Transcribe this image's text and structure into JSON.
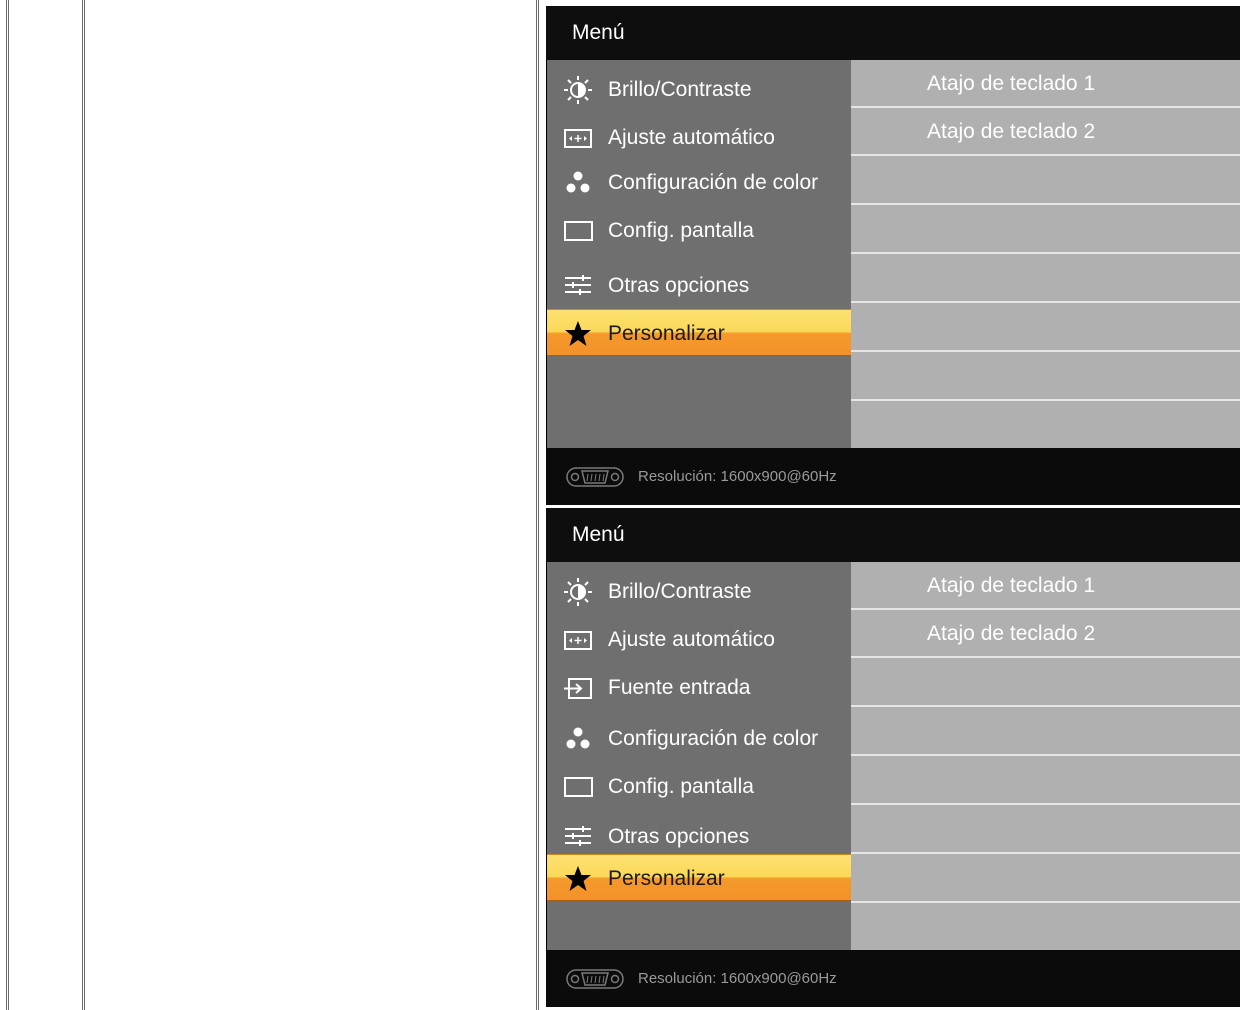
{
  "osd_one": {
    "title": "Menú",
    "menu": [
      {
        "label": "Brillo/Contraste",
        "icon": "brightness-icon"
      },
      {
        "label": "Ajuste automático",
        "icon": "auto-adjust-icon"
      },
      {
        "label": "Configuración de color",
        "icon": "color-dots-icon"
      },
      {
        "label": "Config. pantalla",
        "icon": "display-rect-icon"
      },
      {
        "label": "Otras opciones",
        "icon": "sliders-icon"
      },
      {
        "label": "Personalizar",
        "icon": "star-icon",
        "selected": true
      }
    ],
    "submenu": [
      "Atajo de teclado 1",
      "Atajo de teclado 2"
    ],
    "footer": {
      "resolution": "Resolución:  1600x900@60Hz",
      "icon": "vga-connector-icon"
    }
  },
  "osd_two": {
    "title": "Menú",
    "menu": [
      {
        "label": "Brillo/Contraste",
        "icon": "brightness-icon"
      },
      {
        "label": "Ajuste automático",
        "icon": "auto-adjust-icon"
      },
      {
        "label": "Fuente entrada",
        "icon": "input-source-icon"
      },
      {
        "label": "Configuración de color",
        "icon": "color-dots-icon"
      },
      {
        "label": "Config. pantalla",
        "icon": "display-rect-icon"
      },
      {
        "label": "Otras opciones",
        "icon": "sliders-icon"
      },
      {
        "label": "Personalizar",
        "icon": "star-icon",
        "selected": true
      }
    ],
    "submenu": [
      "Atajo de teclado 1",
      "Atajo de teclado 2"
    ],
    "footer": {
      "resolution": "Resolución:  1600x900@60Hz",
      "icon": "vga-connector-icon"
    }
  },
  "colors": {
    "selected_top": "#fde272",
    "selected_bottom": "#f3912a",
    "left_panel": "#6f6f6f",
    "right_panel": "#b0b0b0"
  }
}
